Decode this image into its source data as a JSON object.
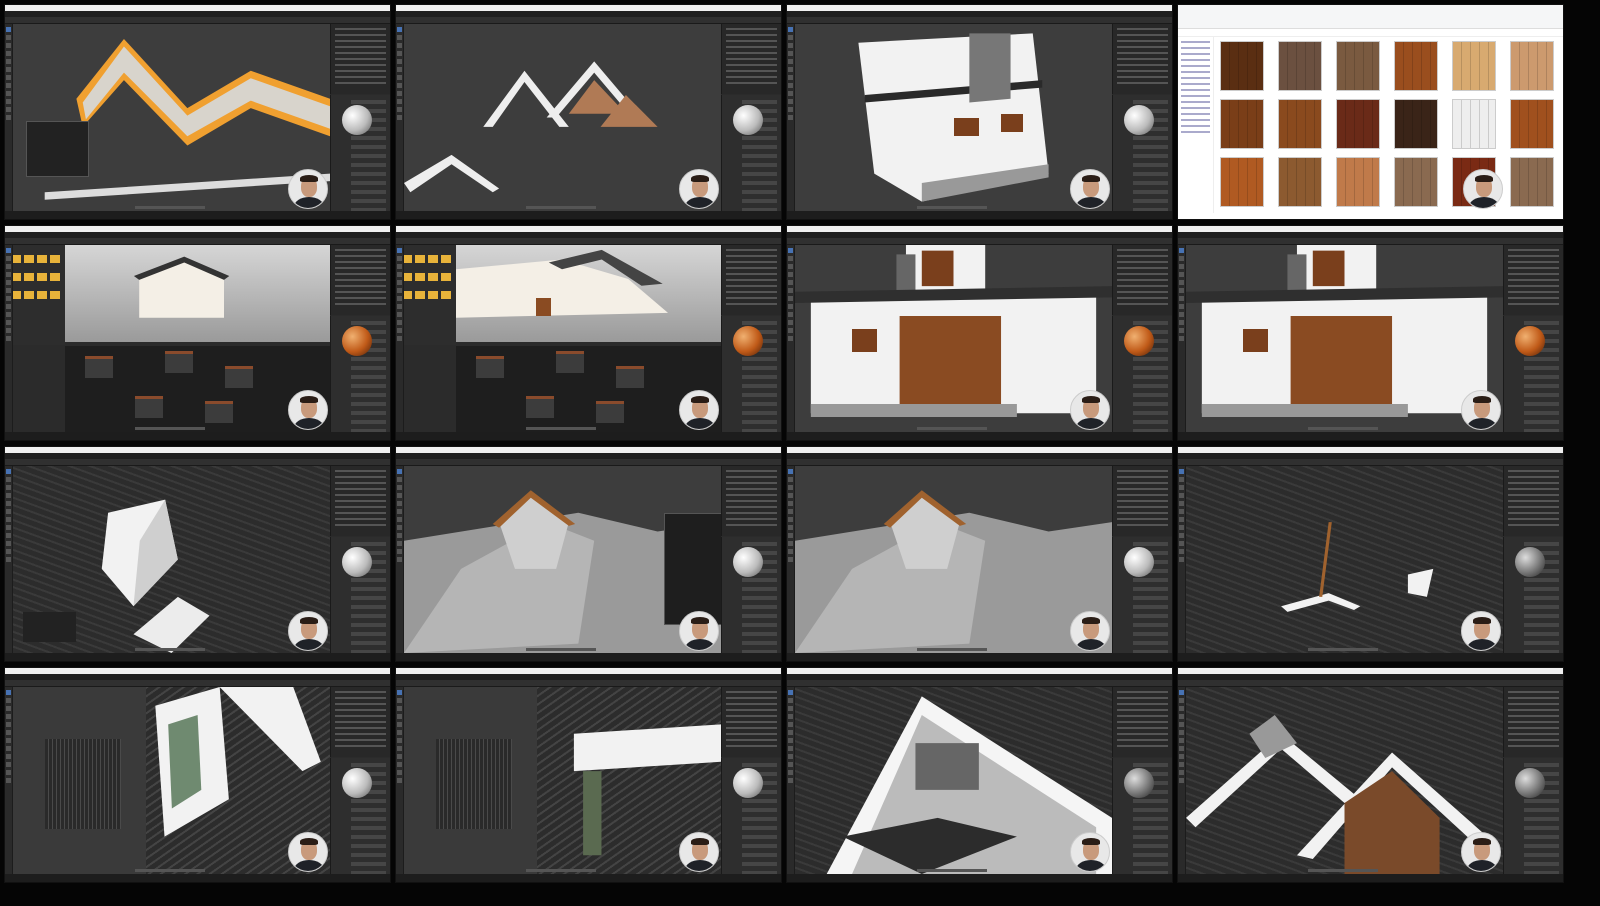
{
  "sheet": {
    "columns": 4,
    "rows": 4
  },
  "colors": {
    "blender_bg": "#2b2b2b",
    "viewport": "#3d3d3d",
    "accent": "#4772b3",
    "roof_tile": "#2c2c2c",
    "wood": "#8a4b22",
    "wall": "#f2f2f2",
    "orange_outline": "#f0a030"
  },
  "panels": [
    {
      "scene": "roof-outline-orange"
    },
    {
      "scene": "roof-trusses"
    },
    {
      "scene": "house-corner"
    },
    {
      "scene": "file-explorer-wood-textures"
    },
    {
      "scene": "house-model-with-nodes"
    },
    {
      "scene": "house-render-with-nodes"
    },
    {
      "scene": "house-facade-wood"
    },
    {
      "scene": "house-facade-wood-wide"
    },
    {
      "scene": "roof-tiles-box"
    },
    {
      "scene": "dormer-grey-menu"
    },
    {
      "scene": "dormer-grey"
    },
    {
      "scene": "roof-tiles-dark"
    },
    {
      "scene": "window-uv-tiles"
    },
    {
      "scene": "window-uv-tiles-2"
    },
    {
      "scene": "gable-stone"
    },
    {
      "scene": "gables-white"
    }
  ]
}
